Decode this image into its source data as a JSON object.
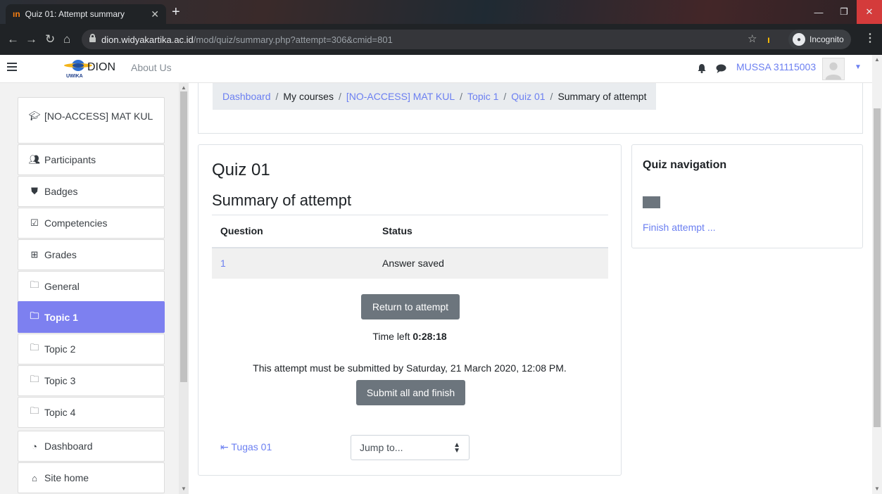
{
  "browser": {
    "tab_title": "Quiz 01: Attempt summary",
    "url_host": "dion.widyakartika.ac.id",
    "url_path": "/mod/quiz/summary.php?attempt=306&cmid=801",
    "incognito_label": "Incognito"
  },
  "navbar": {
    "brand": "DION",
    "logo_text": "UWIKA",
    "about": "About Us",
    "username": "MUSSA 31115003"
  },
  "sidebar": {
    "items": [
      {
        "label": "[NO-ACCESS] MAT KUL",
        "icon": "graduation-cap-icon"
      },
      {
        "label": "Participants",
        "icon": "users-icon"
      },
      {
        "label": "Badges",
        "icon": "shield-icon"
      },
      {
        "label": "Competencies",
        "icon": "checkbox-icon"
      },
      {
        "label": "Grades",
        "icon": "table-icon"
      },
      {
        "label": "General",
        "icon": "folder-icon"
      },
      {
        "label": "Topic 1",
        "icon": "folder-icon",
        "active": true
      },
      {
        "label": "Topic 2",
        "icon": "folder-icon"
      },
      {
        "label": "Topic 3",
        "icon": "folder-icon"
      },
      {
        "label": "Topic 4",
        "icon": "folder-icon"
      },
      {
        "label": "Dashboard",
        "icon": "tachometer-icon"
      },
      {
        "label": "Site home",
        "icon": "home-icon"
      }
    ]
  },
  "breadcrumb": {
    "items": [
      "Dashboard",
      "My courses",
      "[NO-ACCESS] MAT KUL",
      "Topic 1",
      "Quiz 01",
      "Summary of attempt"
    ]
  },
  "quiz": {
    "title": "Quiz 01",
    "subtitle": "Summary of attempt",
    "table": {
      "headers": [
        "Question",
        "Status"
      ],
      "rows": [
        {
          "question": "1",
          "status": "Answer saved"
        }
      ]
    },
    "return_button": "Return to attempt",
    "time_left_label": "Time left",
    "time_left_value": "0:28:18",
    "deadline_text": "This attempt must be submitted by Saturday, 21 March 2020, 12:08 PM.",
    "submit_button": "Submit all and finish",
    "prev_link": "Tugas 01",
    "jump_placeholder": "Jump to..."
  },
  "quiz_navigation": {
    "title": "Quiz navigation",
    "finish_link": "Finish attempt ..."
  },
  "colors": {
    "accent": "#7d80f0",
    "link": "#6b7ff1",
    "button": "#6c757d"
  }
}
